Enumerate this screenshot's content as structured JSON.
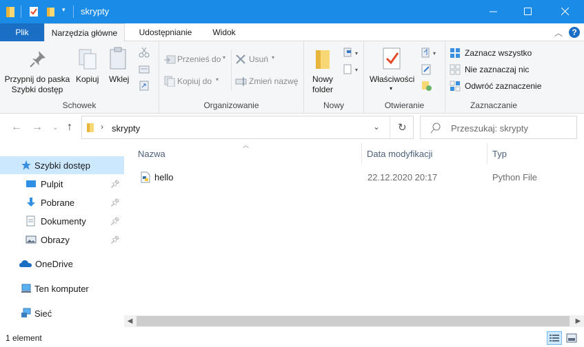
{
  "window": {
    "title": "skrypty",
    "accent_color": "#1a8be6",
    "controls": {
      "minimize": "minimize-icon",
      "maximize": "maximize-icon",
      "close": "close-icon"
    }
  },
  "ribbon_tabs": {
    "file": "Plik",
    "home": "Narzędzia główne",
    "share": "Udostępnianie",
    "view": "Widok"
  },
  "ribbon": {
    "clipboard": {
      "pin_label_1": "Przypnij do paska",
      "pin_label_2": "Szybki dostęp",
      "copy": "Kopiuj",
      "paste": "Wklej",
      "group": "Schowek"
    },
    "organize": {
      "move_to": "Przenieś do",
      "copy_to": "Kopiuj do",
      "delete": "Usuń",
      "rename": "Zmień nazwę",
      "group": "Organizowanie"
    },
    "new": {
      "new_folder_1": "Nowy",
      "new_folder_2": "folder",
      "group": "Nowy"
    },
    "open": {
      "properties": "Właściwości",
      "group": "Otwieranie"
    },
    "select": {
      "select_all": "Zaznacz wszystko",
      "select_none": "Nie zaznaczaj nic",
      "invert": "Odwróć zaznaczenie",
      "group": "Zaznaczanie"
    }
  },
  "address": {
    "path": "skrypty",
    "search_placeholder": "Przeszukaj: skrypty"
  },
  "nav": {
    "quick_access": "Szybki dostęp",
    "items": [
      {
        "label": "Pulpit"
      },
      {
        "label": "Pobrane"
      },
      {
        "label": "Dokumenty"
      },
      {
        "label": "Obrazy"
      }
    ],
    "onedrive": "OneDrive",
    "this_pc": "Ten komputer",
    "network": "Sieć"
  },
  "file_list": {
    "columns": {
      "name": "Nazwa",
      "modified": "Data modyfikacji",
      "type": "Typ"
    },
    "rows": [
      {
        "name": "hello",
        "modified": "22.12.2020 20:17",
        "type": "Python File"
      }
    ]
  },
  "status": {
    "count": "1 element"
  }
}
